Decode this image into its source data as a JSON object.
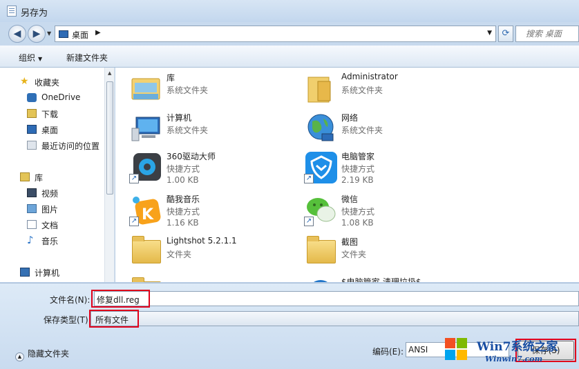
{
  "window": {
    "title": "另存为"
  },
  "address": {
    "location": "桌面",
    "search_placeholder": "搜索 桌面"
  },
  "toolbar": {
    "organize": "组织",
    "new_folder": "新建文件夹"
  },
  "nav": {
    "favorites": "收藏夹",
    "favorites_items": [
      "OneDrive",
      "下载",
      "桌面",
      "最近访问的位置"
    ],
    "libraries": "库",
    "libraries_items": [
      "视频",
      "图片",
      "文档",
      "音乐"
    ],
    "computer": "计算机"
  },
  "files": [
    {
      "name": "库",
      "type": "系统文件夹",
      "size": ""
    },
    {
      "name": "Administrator",
      "type": "系统文件夹",
      "size": ""
    },
    {
      "name": "计算机",
      "type": "系统文件夹",
      "size": ""
    },
    {
      "name": "网络",
      "type": "系统文件夹",
      "size": ""
    },
    {
      "name": "360驱动大师",
      "type": "快捷方式",
      "size": "1.00 KB"
    },
    {
      "name": "电脑管家",
      "type": "快捷方式",
      "size": "2.19 KB"
    },
    {
      "name": "酷我音乐",
      "type": "快捷方式",
      "size": "1.16 KB"
    },
    {
      "name": "微信",
      "type": "快捷方式",
      "size": "1.08 KB"
    },
    {
      "name": "Lightshot 5.2.1.1",
      "type": "文件夹",
      "size": ""
    },
    {
      "name": "截图",
      "type": "文件夹",
      "size": ""
    },
    {
      "name": "$电脑管家-清理垃圾$",
      "type": "",
      "size": ""
    }
  ],
  "form": {
    "filename_label": "文件名(N):",
    "filename_value": "修复dll.reg",
    "filetype_label": "保存类型(T):",
    "filetype_value": "所有文件",
    "hide_folders": "隐藏文件夹",
    "encoding_label": "编码(E):",
    "encoding_value": "ANSI",
    "save_button": "保存(S)"
  },
  "watermark": {
    "brand": "Win7系统之家",
    "url": "Winwin7.com"
  },
  "colors": {
    "highlight_red": "#e0001a",
    "shortcut_arrow": "#2164b5"
  }
}
